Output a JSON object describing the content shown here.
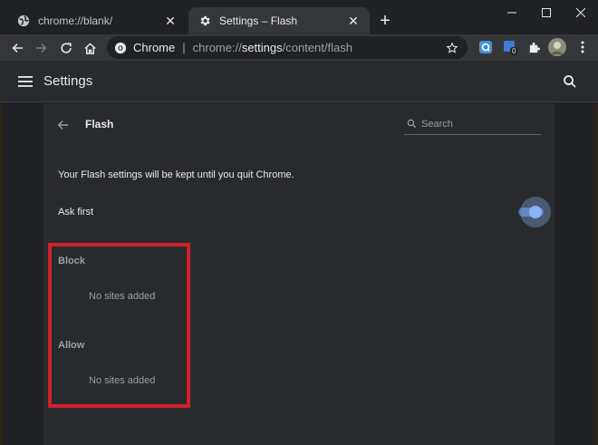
{
  "tabs": [
    {
      "title": "chrome://blank/",
      "active": false,
      "icon": "globe-icon"
    },
    {
      "title": "Settings – Flash",
      "active": true,
      "icon": "gear-icon"
    }
  ],
  "toolbar": {
    "site_label": "Chrome",
    "separator": "|",
    "url_prefix": "chrome://",
    "url_host": "settings",
    "url_path": "/content/flash",
    "extension_badge": "0"
  },
  "settings": {
    "title": "Settings"
  },
  "subpage": {
    "title": "Flash",
    "search_placeholder": "Search",
    "info_text": "Your Flash settings will be kept until you quit Chrome.",
    "ask_first_label": "Ask first",
    "ask_first_enabled": true,
    "block_label": "Block",
    "block_empty": "No sites added",
    "allow_label": "Allow",
    "allow_empty": "No sites added"
  },
  "colors": {
    "accent": "#8ab4f8",
    "highlight": "#d0212b",
    "background": "#202124",
    "card": "#292a2d"
  }
}
